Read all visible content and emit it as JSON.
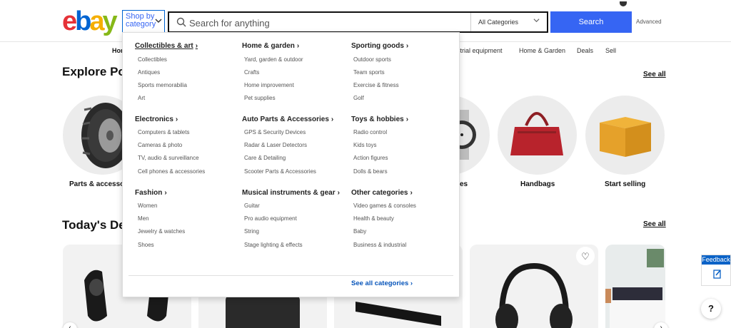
{
  "header": {
    "logo": {
      "e": "e",
      "b": "b",
      "a": "a",
      "y": "y"
    },
    "shop_by_label_line1": "Shop by",
    "shop_by_label_line2": "category",
    "search_placeholder": "Search for anything",
    "category_select_value": "All Categories",
    "search_button_label": "Search",
    "advanced_label": "Advanced"
  },
  "nav": {
    "items": [
      "Hom",
      "strial equipment",
      "Home & Garden",
      "Deals",
      "Sell"
    ]
  },
  "explore": {
    "title": "Explore Po",
    "see_all": "See all",
    "tiles": [
      {
        "label": "Parts & accesso",
        "image": "tire-image"
      },
      {
        "label": "es",
        "image": "watch-image"
      },
      {
        "label": "Handbags",
        "image": "handbag-image"
      },
      {
        "label": "Start selling",
        "image": "box-image"
      }
    ]
  },
  "deals": {
    "title": "Today's De",
    "see_all": "See all"
  },
  "dropdown": {
    "columns": [
      {
        "groups": [
          {
            "heading": "Collectibles & art",
            "items": [
              "Collectibles",
              "Antiques",
              "Sports memorabilia",
              "Art"
            ]
          },
          {
            "heading": "Electronics",
            "items": [
              "Computers & tablets",
              "Cameras & photo",
              "TV, audio & surveillance",
              "Cell phones & accessories"
            ]
          },
          {
            "heading": "Fashion",
            "items": [
              "Women",
              "Men",
              "Jewelry & watches",
              "Shoes"
            ]
          }
        ]
      },
      {
        "groups": [
          {
            "heading": "Home & garden",
            "items": [
              "Yard, garden & outdoor",
              "Crafts",
              "Home improvement",
              "Pet supplies"
            ]
          },
          {
            "heading": "Auto Parts & Accessories",
            "items": [
              "GPS & Security Devices",
              "Radar & Laser Detectors",
              "Care & Detailing",
              "Scooter Parts & Accessories"
            ]
          },
          {
            "heading": "Musical instruments & gear",
            "items": [
              "Guitar",
              "Pro audio equipment",
              "String",
              "Stage lighting & effects"
            ]
          }
        ]
      },
      {
        "groups": [
          {
            "heading": "Sporting goods",
            "items": [
              "Outdoor sports",
              "Team sports",
              "Exercise & fitness",
              "Golf"
            ]
          },
          {
            "heading": "Toys & hobbies",
            "items": [
              "Radio control",
              "Kids toys",
              "Action figures",
              "Dolls & bears"
            ]
          },
          {
            "heading": "Other categories",
            "items": [
              "Video games & consoles",
              "Health & beauty",
              "Baby",
              "Business & industrial"
            ]
          }
        ]
      }
    ],
    "see_all_categories": "See all categories"
  },
  "widgets": {
    "feedback_label": "Feedback",
    "help_label": "?"
  },
  "colors": {
    "accent": "#3665f3",
    "link": "#0654ba",
    "logo_red": "#e53238",
    "logo_blue": "#0064d2",
    "logo_yellow": "#f5af02",
    "logo_green": "#86b817"
  }
}
